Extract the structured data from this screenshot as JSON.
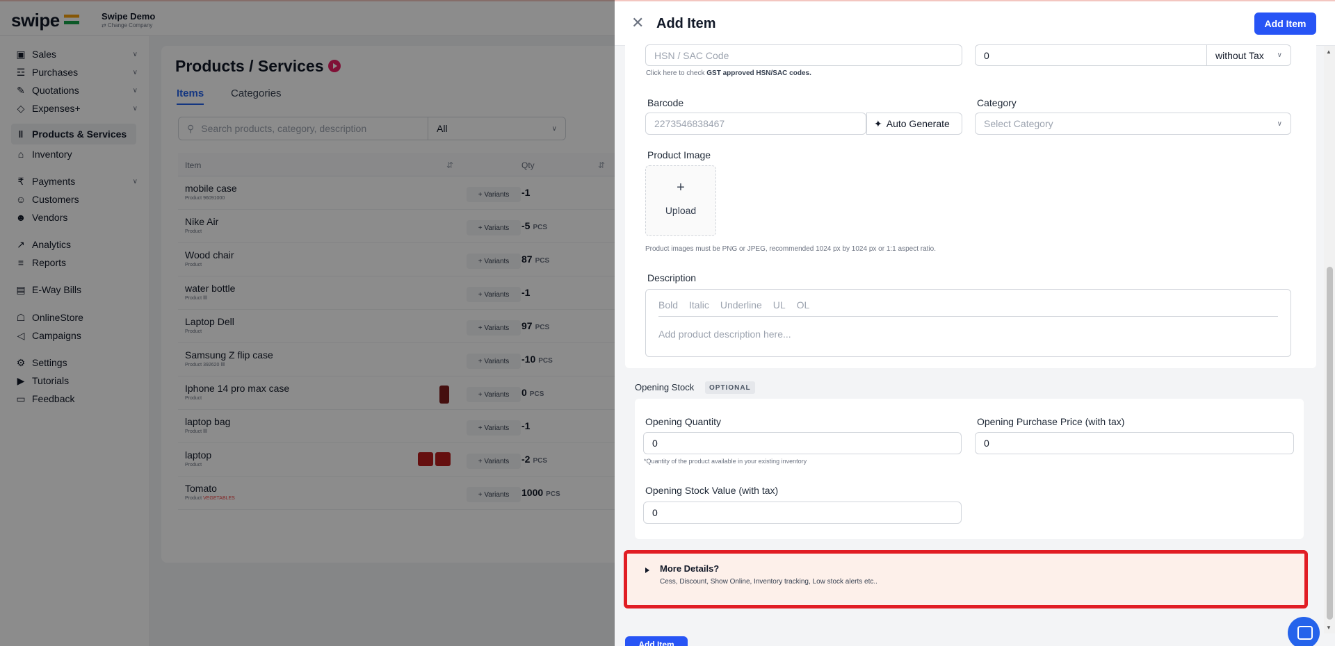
{
  "header": {
    "brand": "swipe",
    "company_name": "Swipe Demo",
    "company_sub": "⇄ Change Company"
  },
  "sidebar": {
    "items": [
      {
        "label": "Sales",
        "icon": "sales-icon",
        "expand": true
      },
      {
        "label": "Purchases",
        "icon": "cart-icon",
        "expand": true
      },
      {
        "label": "Quotations",
        "icon": "pen-icon",
        "expand": true
      },
      {
        "label": "Expenses+",
        "icon": "tag-icon",
        "expand": true
      },
      {
        "label": "Products & Services",
        "icon": "barcode-icon",
        "expand": false,
        "active": true
      },
      {
        "label": "Inventory",
        "icon": "warehouse-icon",
        "expand": false
      },
      {
        "label": "Payments",
        "icon": "rupee-icon",
        "expand": true
      },
      {
        "label": "Customers",
        "icon": "user-icon",
        "expand": false
      },
      {
        "label": "Vendors",
        "icon": "users-icon",
        "expand": false
      },
      {
        "label": "Analytics",
        "icon": "chart-icon",
        "expand": false
      },
      {
        "label": "Reports",
        "icon": "report-icon",
        "expand": false
      },
      {
        "label": "E-Way Bills",
        "icon": "truck-icon",
        "expand": false
      },
      {
        "label": "OnlineStore",
        "icon": "store-icon",
        "expand": false
      },
      {
        "label": "Campaigns",
        "icon": "megaphone-icon",
        "expand": false
      },
      {
        "label": "Settings",
        "icon": "gear-icon",
        "expand": false
      },
      {
        "label": "Tutorials",
        "icon": "play-icon",
        "expand": false
      },
      {
        "label": "Feedback",
        "icon": "feedback-icon",
        "expand": false
      }
    ]
  },
  "products": {
    "title": "Products / Services",
    "tabs": [
      "Items",
      "Categories"
    ],
    "search_placeholder": "Search products, category, description",
    "filter_value": "All",
    "columns": [
      "Item",
      "Qty"
    ],
    "variants_label": "+ Variants",
    "rows": [
      {
        "name": "mobile case",
        "sub": "Product  96091000",
        "qty": "-1",
        "unit": ""
      },
      {
        "name": "Nike Air",
        "sub": "Product",
        "qty": "-5",
        "unit": "PCS"
      },
      {
        "name": "Wood chair",
        "sub": "Product",
        "qty": "87",
        "unit": "PCS"
      },
      {
        "name": "water bottle",
        "sub": "Product  ‖‖",
        "qty": "-1",
        "unit": ""
      },
      {
        "name": "Laptop Dell",
        "sub": "Product",
        "qty": "97",
        "unit": "PCS"
      },
      {
        "name": "Samsung Z flip case",
        "sub": "Product  392620  ‖‖",
        "qty": "-10",
        "unit": "PCS"
      },
      {
        "name": "Iphone 14 pro max case",
        "sub": "Product",
        "qty": "0",
        "unit": "PCS"
      },
      {
        "name": "laptop bag",
        "sub": "Product  ‖‖",
        "qty": "-1",
        "unit": ""
      },
      {
        "name": "laptop",
        "sub": "Product",
        "qty": "-2",
        "unit": "PCS"
      },
      {
        "name": "Tomato",
        "sub": "Product",
        "sub_tag": "VEGETABLES",
        "qty": "1000",
        "unit": "PCS"
      }
    ]
  },
  "drawer": {
    "title": "Add Item",
    "add_button": "Add Item",
    "hsn_placeholder": "HSN / SAC Code",
    "hsn_hint_prefix": "Click here to check ",
    "hsn_hint_bold": "GST approved HSN/SAC codes.",
    "price_value": "0",
    "tax_mode": "without Tax",
    "barcode_label": "Barcode",
    "barcode_placeholder": "2273546838467",
    "auto_generate": "Auto Generate",
    "category_label": "Category",
    "category_placeholder": "Select Category",
    "product_image_label": "Product Image",
    "upload_plus": "+",
    "upload_label": "Upload",
    "image_hint": "Product images must be PNG or JPEG, recommended 1024 px by 1024 px or 1:1 aspect ratio.",
    "description_label": "Description",
    "editor_tools": [
      "Bold",
      "Italic",
      "Underline",
      "UL",
      "OL"
    ],
    "description_placeholder": "Add product description here...",
    "opening_stock_label": "Opening Stock",
    "optional_badge": "OPTIONAL",
    "opening_qty_label": "Opening Quantity",
    "opening_qty_value": "0",
    "opening_qty_hint": "*Quantity of the product available in your existing inventory",
    "opening_price_label": "Opening Purchase Price (with tax)",
    "opening_price_value": "0",
    "opening_value_label": "Opening Stock Value (with tax)",
    "opening_value_value": "0",
    "more_title": "More Details?",
    "more_sub": "Cess, Discount, Show Online, Inventory tracking, Low stock alerts etc..",
    "footer_button": "Add Item"
  },
  "colors": {
    "primary": "#2754f5",
    "highlight_border": "#e11d24",
    "more_bg": "#fdf0ea",
    "brand_pink": "#e91e63"
  }
}
